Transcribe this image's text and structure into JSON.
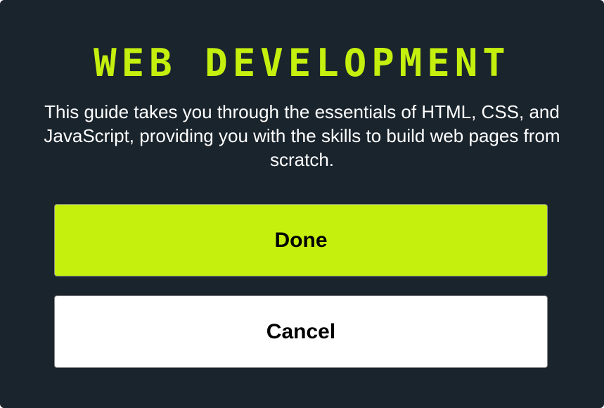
{
  "dialog": {
    "title": "WEB DEVELOPMENT",
    "description": "This guide takes you through the essentials of HTML, CSS, and JavaScript, providing you with the skills to build web pages from scratch.",
    "done_label": "Done",
    "cancel_label": "Cancel"
  },
  "colors": {
    "background": "#1a242d",
    "accent": "#c5f00e",
    "cancel_bg": "#ffffff",
    "text": "#ffffff"
  }
}
